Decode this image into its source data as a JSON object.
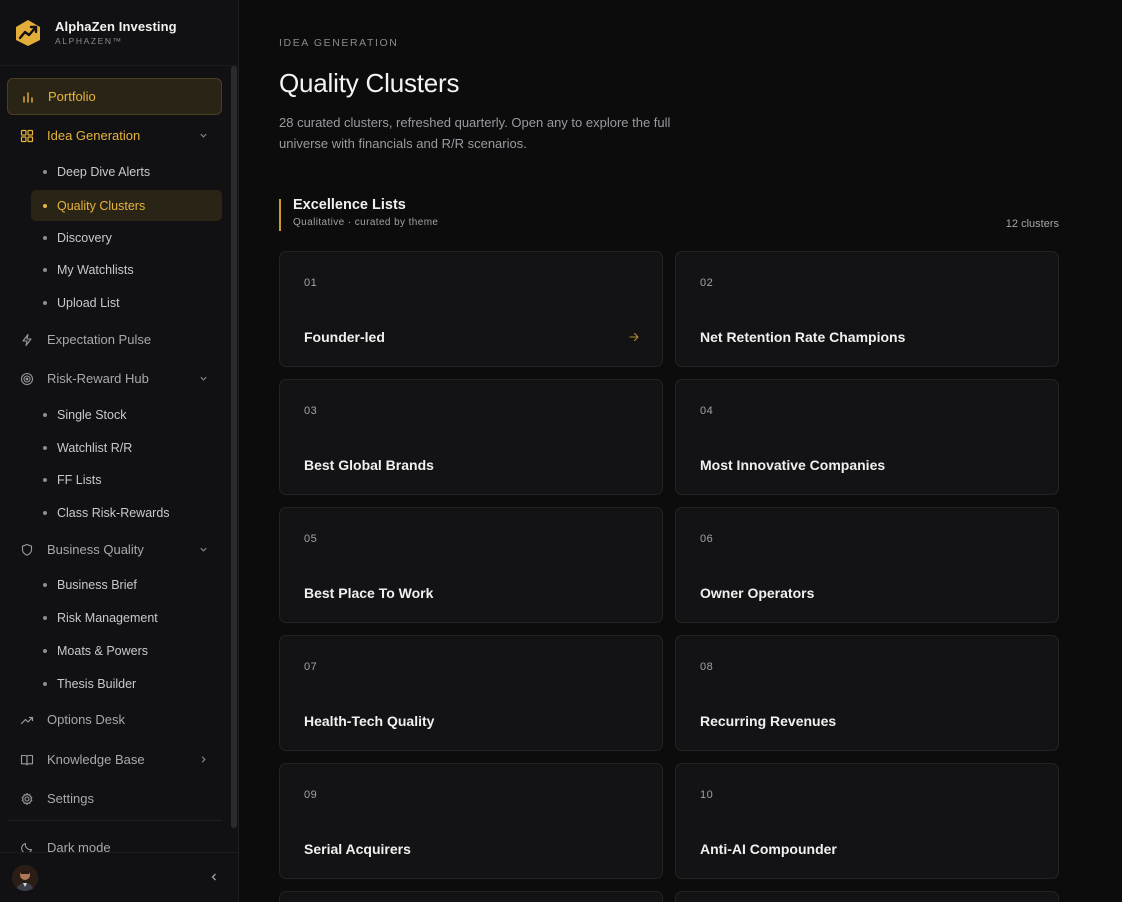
{
  "brand": {
    "title": "AlphaZen Investing",
    "subtitle": "ALPHAZEN™"
  },
  "colors": {
    "accent": "#e7b43c",
    "background": "#0c0c0d",
    "sidebar": "#111113",
    "card": "#131315"
  },
  "sidebar": {
    "portfolio": "Portfolio",
    "idea_generation": "Idea Generation",
    "idea_children": [
      "Deep Dive Alerts",
      "Quality Clusters",
      "Discovery",
      "My Watchlists",
      "Upload List"
    ],
    "expectation_pulse": "Expectation Pulse",
    "risk_reward_hub": "Risk-Reward Hub",
    "rr_children": [
      "Single Stock",
      "Watchlist R/R",
      "FF Lists",
      "Class Risk-Rewards"
    ],
    "business_quality": "Business Quality",
    "bq_children": [
      "Business Brief",
      "Risk Management",
      "Moats & Powers",
      "Thesis Builder"
    ],
    "options_desk": "Options Desk",
    "knowledge_base": "Knowledge Base",
    "settings": "Settings",
    "dark_mode": "Dark mode"
  },
  "page": {
    "eyebrow": "IDEA GENERATION",
    "title": "Quality Clusters",
    "description": "28 curated clusters, refreshed quarterly. Open any to explore the full universe with financials and R/R scenarios."
  },
  "section": {
    "title": "Excellence Lists",
    "subtitle": "Qualitative · curated by theme",
    "count": "12 clusters"
  },
  "cards": [
    {
      "num": "01",
      "title": "Founder-led"
    },
    {
      "num": "02",
      "title": "Net Retention Rate Champions"
    },
    {
      "num": "03",
      "title": "Best Global Brands"
    },
    {
      "num": "04",
      "title": "Most Innovative Companies"
    },
    {
      "num": "05",
      "title": "Best Place To Work"
    },
    {
      "num": "06",
      "title": "Owner Operators"
    },
    {
      "num": "07",
      "title": "Health-Tech Quality"
    },
    {
      "num": "08",
      "title": "Recurring Revenues"
    },
    {
      "num": "09",
      "title": "Serial Acquirers"
    },
    {
      "num": "10",
      "title": "Anti-AI Compounder"
    }
  ]
}
